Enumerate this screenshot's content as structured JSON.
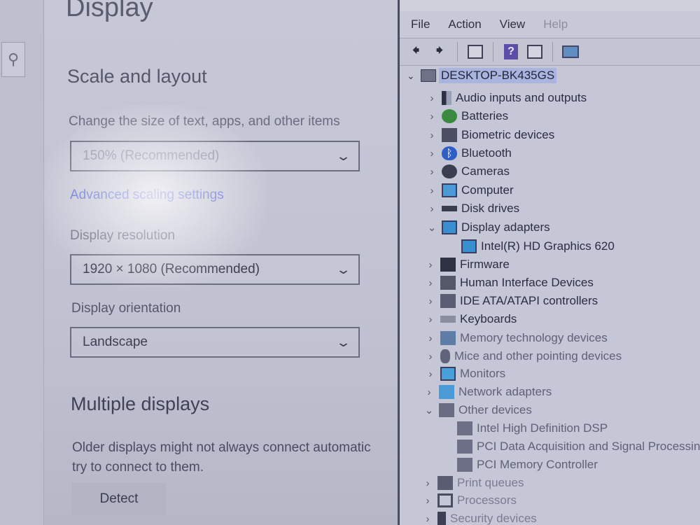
{
  "settings": {
    "page_title": "Display",
    "scale_section": "Scale and layout",
    "scale_label": "Change the size of text, apps, and other items",
    "scale_value": "150% (Recommended)",
    "advanced_link": "Advanced scaling settings",
    "resolution_label": "Display resolution",
    "resolution_value": "1920 × 1080 (Recommended)",
    "orientation_label": "Display orientation",
    "orientation_value": "Landscape",
    "multi_section": "Multiple displays",
    "multi_text_line1": "Older displays might not always connect automatic",
    "multi_text_line2": "try to connect to them.",
    "detect_label": "Detect",
    "search_icon": "search-icon",
    "chevron_icon": "chevron-down-icon"
  },
  "devmgr": {
    "menu": {
      "file": "File",
      "action": "Action",
      "view": "View",
      "help": "Help"
    },
    "root": "DESKTOP-BK435GS",
    "items": [
      {
        "label": "Audio inputs and outputs",
        "expander": "›",
        "icon": "audio-icon"
      },
      {
        "label": "Batteries",
        "expander": "›",
        "icon": "battery-icon"
      },
      {
        "label": "Biometric devices",
        "expander": "›",
        "icon": "biometric-icon"
      },
      {
        "label": "Bluetooth",
        "expander": "›",
        "icon": "bluetooth-icon"
      },
      {
        "label": "Cameras",
        "expander": "›",
        "icon": "camera-icon"
      },
      {
        "label": "Computer",
        "expander": "›",
        "icon": "computer-icon"
      },
      {
        "label": "Disk drives",
        "expander": "›",
        "icon": "disk-icon"
      },
      {
        "label": "Display adapters",
        "expander": "⌄",
        "icon": "display-adapter-icon"
      },
      {
        "label": "Intel(R) HD Graphics 620",
        "expander": "",
        "icon": "display-adapter-icon"
      },
      {
        "label": "Firmware",
        "expander": "›",
        "icon": "firmware-icon"
      },
      {
        "label": "Human Interface Devices",
        "expander": "›",
        "icon": "hid-icon"
      },
      {
        "label": "IDE ATA/ATAPI controllers",
        "expander": "›",
        "icon": "ide-icon"
      },
      {
        "label": "Keyboards",
        "expander": "›",
        "icon": "keyboard-icon"
      },
      {
        "label": "Memory technology devices",
        "expander": "›",
        "icon": "memory-icon"
      },
      {
        "label": "Mice and other pointing devices",
        "expander": "›",
        "icon": "mouse-icon"
      },
      {
        "label": "Monitors",
        "expander": "›",
        "icon": "monitor-icon"
      },
      {
        "label": "Network adapters",
        "expander": "›",
        "icon": "network-icon"
      },
      {
        "label": "Other devices",
        "expander": "⌄",
        "icon": "other-devices-icon"
      },
      {
        "label": "Intel High Definition DSP",
        "expander": "",
        "icon": "warning-device-icon"
      },
      {
        "label": "PCI Data Acquisition and Signal Processing",
        "expander": "",
        "icon": "warning-device-icon"
      },
      {
        "label": "PCI Memory Controller",
        "expander": "",
        "icon": "warning-device-icon"
      },
      {
        "label": "Print queues",
        "expander": "›",
        "icon": "printer-icon"
      },
      {
        "label": "Processors",
        "expander": "›",
        "icon": "processor-icon"
      },
      {
        "label": "Security devices",
        "expander": "›",
        "icon": "security-icon"
      }
    ]
  }
}
